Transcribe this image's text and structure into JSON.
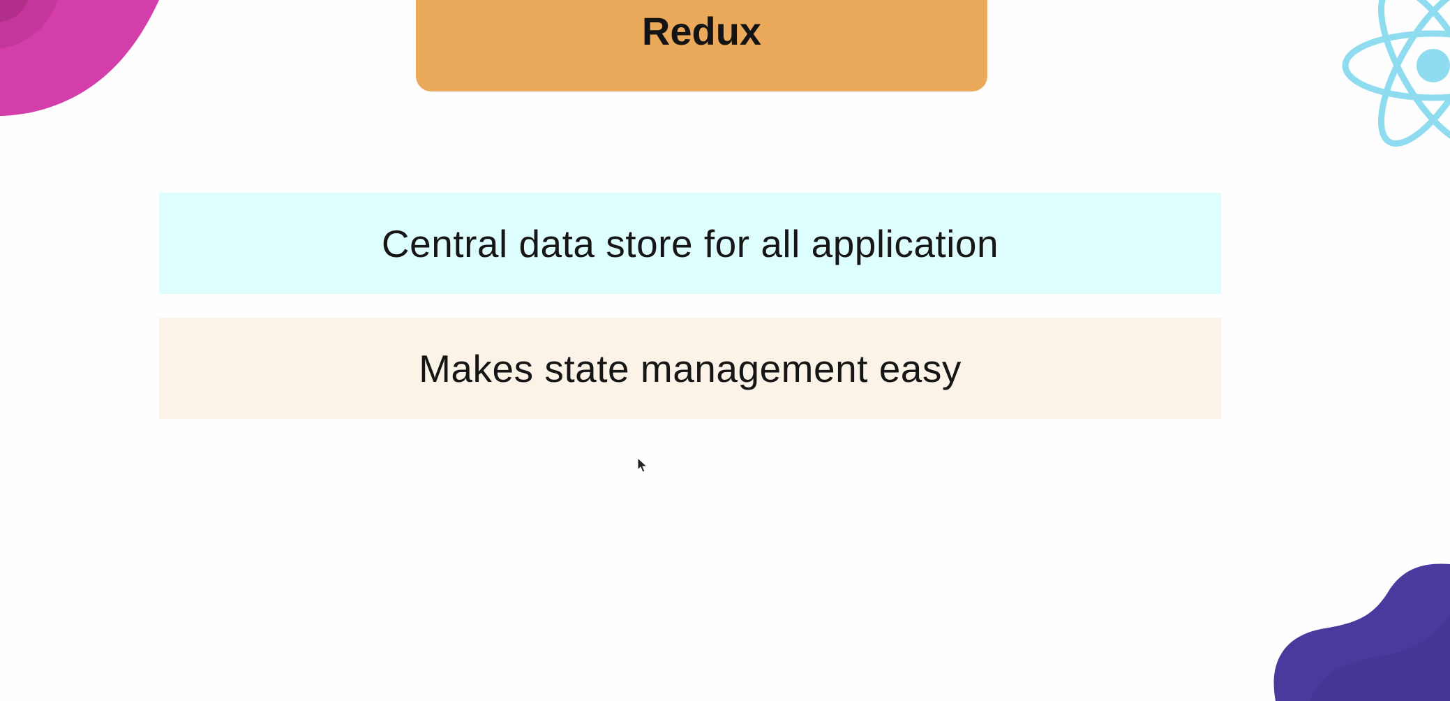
{
  "slide": {
    "title": "Redux",
    "points": [
      "Central data store for all application",
      "Makes state management easy"
    ]
  },
  "decorations": {
    "top_left_blob_icon": "pink-blob",
    "react_logo_icon": "react-atom-icon",
    "bottom_right_blob_icon": "purple-blob",
    "cursor_icon": "mouse-pointer-icon"
  },
  "colors": {
    "title_card": "#eba95b",
    "point_1_background": "#defdfd",
    "point_2_background": "#fbf3e8",
    "pink_blob": "#d33eaa",
    "react_logo": "#8fdcf0",
    "purple_blob": "#4a3a9e"
  }
}
